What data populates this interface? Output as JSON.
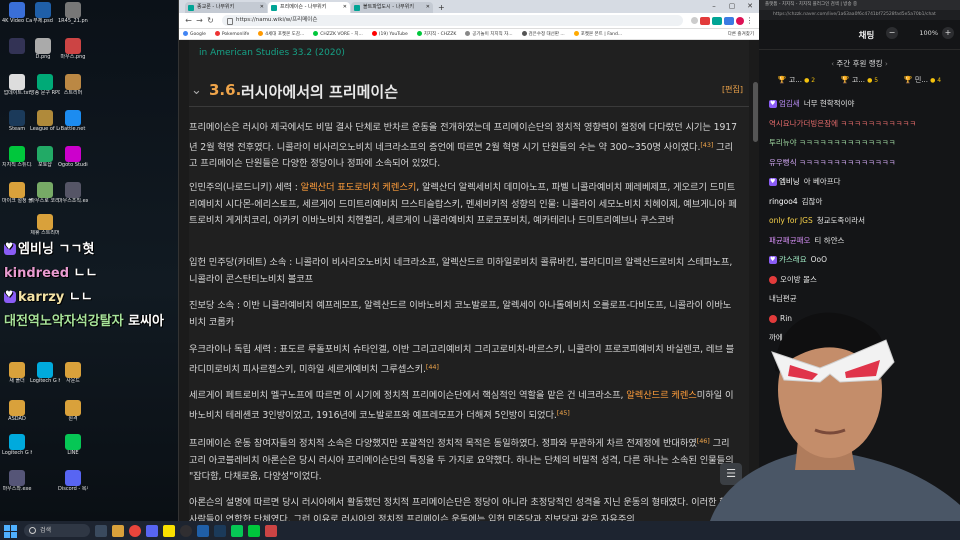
{
  "desktop": {
    "icons": [
      {
        "label": "4K Video Capture",
        "color": "#3a6fd8"
      },
      {
        "label": "무제.psd",
        "color": "#1f5fa8"
      },
      {
        "label": "1R45_21.png",
        "color": "#777"
      },
      {
        "label": "",
        "color": "#335"
      },
      {
        "label": "D.png",
        "color": "#aaa"
      },
      {
        "label": "마우스.png",
        "color": "#c44"
      },
      {
        "label": "",
        "color": "#553"
      },
      {
        "label": "업데이트.txt",
        "color": "#ddd"
      },
      {
        "label": "방송 문구 RPD",
        "color": "#0a7"
      },
      {
        "label": "스트리머",
        "color": "#b84"
      },
      {
        "label": "Steam",
        "color": "#1b3a5a"
      },
      {
        "label": "League of Legends",
        "color": "#b08a3a"
      },
      {
        "label": "Battle.net",
        "color": "#1c8cf0"
      },
      {
        "label": "치지직 스튜디오",
        "color": "#00c73c"
      },
      {
        "label": "포토샵",
        "color": "#2a6"
      },
      {
        "label": "Ogoto Studio",
        "color": "#c0c"
      },
      {
        "label": "마이크 설정 폴더",
        "color": "#d9a13b"
      },
      {
        "label": "마우스로 코리",
        "color": "#7a6"
      },
      {
        "label": "마우스조직.exe",
        "color": "#556"
      },
      {
        "label": "제휴 스트리머",
        "color": "#d9a13b"
      },
      {
        "label": "새 폴더",
        "color": "#d9a13b"
      },
      {
        "label": "Logitech G HUB",
        "color": "#0ad"
      },
      {
        "label": "사운드",
        "color": "#d9a13b"
      },
      {
        "label": "ASDAD",
        "color": "#d9a13b"
      },
      {
        "label": "원격",
        "color": "#d9a13b"
      },
      {
        "label": "Logitech G HUB",
        "color": "#0ad"
      },
      {
        "label": "LINE",
        "color": "#06c755"
      },
      {
        "label": "마우스좌.exe",
        "color": "#557"
      },
      {
        "label": "Discord - 복사본",
        "color": "#5865f2"
      }
    ],
    "overlay_chat": [
      {
        "nick": "엠비닝",
        "text": "ㄱㄱ혓",
        "nick_color": "#ffffff",
        "badge": true
      },
      {
        "nick": "kindreed",
        "text": "ㄴㄴ",
        "nick_color": "#e89bd0",
        "badge": false
      },
      {
        "nick": "karrzy",
        "text": "ㄴㄴ",
        "nick_color": "#f4e4a6",
        "badge": true
      },
      {
        "nick": "대전역노약자석강탈자",
        "text": "로씨아",
        "nick_color": "#a7e39a",
        "badge": false
      }
    ]
  },
  "browser": {
    "tabs": [
      {
        "label": "종교론 - 나무위키",
        "active": false
      },
      {
        "label": "프리메이슨 - 나무위키",
        "active": true
      },
      {
        "label": "볼트파업도시 - 나무위키",
        "active": false
      }
    ],
    "url": "https://namu.wiki/w/프리메이슨",
    "bookmarks": [
      {
        "label": "Google",
        "color": "#4285f4"
      },
      {
        "label": "Pokemonlife",
        "color": "#e33"
      },
      {
        "label": "4세대 포켓몬 도감...",
        "color": "#f90"
      },
      {
        "label": "CHZZK VORE - 치...",
        "color": "#00c73c"
      },
      {
        "label": "(19) YouTube",
        "color": "#f00"
      },
      {
        "label": "치지직 - CHZZK",
        "color": "#00c73c"
      },
      {
        "label": "공기놀이 치지직 자...",
        "color": "#888"
      },
      {
        "label": "검은수정 대선판 ...",
        "color": "#555"
      },
      {
        "label": "포켓몬 폰트 | Fand...",
        "color": "#fa0"
      }
    ],
    "bookmarks_more": "다른 즐겨찾기"
  },
  "article": {
    "prev_tail": "in American Studies 33.2 (2020)",
    "section_number": "3.6.",
    "section_title": "러시아에서의 프리메이슨",
    "edit_label": "[편집]",
    "p1_a": "프리메이슨은 러시아 제국에서도 비밀 결사 단체로 반차르 운동을 전개하였는데 프리메이슨단의 정치적 영향력이 절정에 다다랐던 시기는 1917년 2월 혁명 전후였다. 니콜라이 비사리오노비치 네크라소프의 증언에 따르면 2월 혁명 시기 단원들의 수는 약 300~350명 사이였다.",
    "p1_ref": "[43]",
    "p1_b": " 그리고 프리메이슨 단원들은 다양한 정당이나 정파에 소속되어 있었다.",
    "p2_a": "인민주의(나로드니키) 세력 : ",
    "p2_hl": "알렉산더 표도로비치 케렌스키",
    "p2_b": ", 알렉산더 알렉세비치 데미아노프, 파벨 니콜라예비치 페레베제프, 게오르기 드미트리예비치 시다몬-에리스토프, 세르게이 드미트리예비치 므스티슬랍스키, 멘셰비키적 성향의 인물: 니콜라이 세모노비치 치헤이제, 예브게니아 페트로비치 게게치코리, 아카키 이바노비치 치헨켈리, 세르게이 니콜라예비치 프로코포비치, 예카테리나 드미트리예브나 쿠스코바",
    "p3": "입헌 민주당(카데트) 소속 : 니콜라이 비사리오노비치 네크라소프, 알렉산드르 미하일로비치 콜류바킨, 블라디미르 알렉산드로비치 스테파노프, 니콜라이 콘스탄티노비치 볼코프",
    "p4": "진보당 소속 : 이반 니콜라예비치 예프레모프, 알렉산드르 이바노비치 코노발로프, 알렉세이 아나톨예비치 오를로프-다비도프, 니콜라이 이바노비치 코롭카",
    "p5_a": "우크라이나 독립 세력 : 표도르 루돌포비치 슈타인겔, 이반 그리고리예비치 그리고로비치-바르스키, 니콜라이 프로코피예비치 바실렌코, 레브 블라디미로비치 피사르젭스키, 미하일 세르게예비치 그루셉스키.",
    "p5_ref": "[44]",
    "p6_a": "세르게이 페트로비치 멜구노프에 따르면 이 시기에 정치적 프리메이슨단에서 핵심적인 역할을 맡은 건 네크라소프, ",
    "p6_hl": "알렉산드르 케렌스",
    "p6_b": "미하일 이바노비치 테레셴코 3인방이었고, 1916년에 코노발로프와 예프레모프가 더해져 5인방이 되었다.",
    "p6_ref": "[45]",
    "p7_a": "프리메이슨 운동 참여자들의 정치적 소속은 다양했지만 포괄적인 정치적 목적은 동일하였다. 정파와 무관하게 차르 전제정에 반대하였",
    "p7_ref": "[46]",
    "p7_b": " 그리고리 아코블레비치 아론슨은 당시 러시아 프리메이슨단의 특징을 두 가지로 요약했다. 하나는 단체의 비밀적 성격, 다른 하나는 소속된 인물들의 \"잡다함, 다채로움, 다양성\"이었다.",
    "p8": "아론슨의 설명에 따르면 당시 러시아에서 활동했던 정치적 프리메이슨단은 정당이 아니라 초정당적인 성격을 지닌 운동의 형태였다. 이러한 했던 사람들이 연합한 단체였다. 그런 이유로 러시아의 정치적 프리메이슨 운동에는 입헌 민주당과 진보당과 같은 자유주의"
  },
  "chat": {
    "tab_text": "플랫폼 - 치지직 - 치지직 플러그인 검색 | 방송 중",
    "url": "https://chzzk.naver.com/live/1a63aa0f6c4741bf72528fad5e5a70b1/chat",
    "title": "채팅",
    "zoom": "100%",
    "ranking_title": "주간 후원 랭킹",
    "ranking": [
      {
        "name": "고...",
        "count": "2"
      },
      {
        "name": "고...",
        "count": "5"
      },
      {
        "name": "민...",
        "count": "4"
      }
    ],
    "messages": [
      {
        "nick": "엄김새",
        "text": "너무 현학적이야",
        "color": "#b98cf5",
        "badge": "member"
      },
      {
        "nick": "",
        "text": "역시요나가더빙은잠에 ㅋㅋㅋㅋㅋㅋㅋㅋㅋㅋㅋ",
        "color": "#e26a6a",
        "badge": "",
        "body_color": "#e26a6a"
      },
      {
        "nick": "",
        "text": "투리뉴야 ㅋㅋㅋㅋㅋㅋㅋㅋㅋㅋㅋㅋㅋㅋ",
        "color": "#9fd8a0",
        "badge": "",
        "body_color": "#9fd8a0"
      },
      {
        "nick": "",
        "text": "유우뻥식 ㅋㅋㅋㅋㅋㅋㅋㅋㅋㅋㅋㅋㅋㅋ",
        "color": "#cfa6f0",
        "badge": "",
        "body_color": "#cfa6f0"
      },
      {
        "nick": "엠비닝",
        "text": "아 베아프다",
        "color": "#ffffff",
        "badge": "member"
      },
      {
        "nick": "ringoo4",
        "text": "김잖아",
        "color": "#ffffff",
        "badge": ""
      },
      {
        "nick": "only for JGS",
        "text": "청교도족이라서",
        "color": "#f5d04a",
        "badge": ""
      },
      {
        "nick": "패균패균패오",
        "text": "티 하얀스",
        "color": "#d38df2",
        "badge": ""
      },
      {
        "nick": "캬스래요",
        "text": "OoO",
        "color": "#9fe8c3",
        "badge": "member"
      },
      {
        "nick": "",
        "text": "오이방 몰스",
        "color": "#d6d6d6",
        "badge": "pokeball"
      },
      {
        "nick": "",
        "text": "내님편균",
        "color": "#aaaaaa",
        "badge": ""
      },
      {
        "nick": "",
        "text": "Rin",
        "color": "#d6d6d6",
        "badge": "pokeball"
      },
      {
        "nick": "",
        "text": "까에",
        "color": "#9ab5d8",
        "badge": ""
      }
    ]
  },
  "taskbar": {
    "search_placeholder": "검색"
  },
  "colors": {
    "accent_orange": "#f0a54a",
    "link_orange": "#ff9d3a",
    "wiki_teal": "#16a085",
    "chzzk_green": "#00c73c"
  }
}
